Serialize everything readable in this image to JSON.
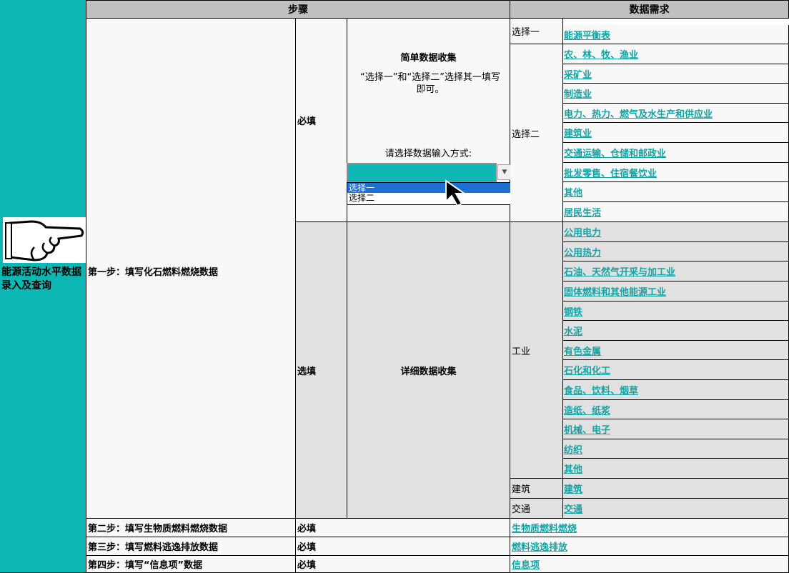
{
  "header": {
    "steps": "步骤",
    "data_req": "数据需求"
  },
  "left_panel": {
    "title": "能源活动水平数据录入及查询"
  },
  "step1": {
    "label": "第一步：填写化石燃料燃烧数据",
    "required": "必填",
    "optional": "选填",
    "simple_title": "简单数据收集",
    "simple_note": "“选择一”和“选择二”选择其一填写即可。",
    "prompt": "请选择数据输入方式:",
    "dropdown_options": [
      "选择一",
      "选择二"
    ],
    "detail_title": "详细数据收集"
  },
  "categories": {
    "choice1": "选择一",
    "choice2": "选择二",
    "industry": "工业",
    "building": "建筑",
    "transport": "交通"
  },
  "choice1_links": [
    "能源平衡表"
  ],
  "choice2_links": [
    "农、林、牧、渔业",
    "采矿业",
    "制造业",
    "电力、热力、燃气及水生产和供应业",
    "建筑业",
    "交通运输、仓储和邮政业",
    "批发零售、住宿餐饮业",
    "其他",
    "居民生活"
  ],
  "industry_links": [
    "公用电力",
    "公用热力",
    "石油、天然气开采与加工业",
    "固体燃料和其他能源工业",
    "钢铁",
    "水泥",
    "有色金属",
    "石化和化工",
    "食品、饮料、烟草",
    "造纸、纸浆",
    "机械、电子",
    "纺织",
    "其他"
  ],
  "building_link": "建筑",
  "transport_link": "交通",
  "steps": [
    {
      "label": "第二步：填写生物质燃料燃烧数据",
      "req": "必填",
      "link": "生物质燃料燃烧"
    },
    {
      "label": "第三步：填写燃料逃逸排放数据",
      "req": "必填",
      "link": "燃料逃逸排放"
    },
    {
      "label": "第四步：填写“信息项”数据",
      "req": "必填",
      "link": "信息项"
    }
  ],
  "colors": {
    "accent": "#0db7b3",
    "link": "#16a3a4",
    "header_bg": "#c0c0c0",
    "detail_bg": "#e1e1e1"
  }
}
